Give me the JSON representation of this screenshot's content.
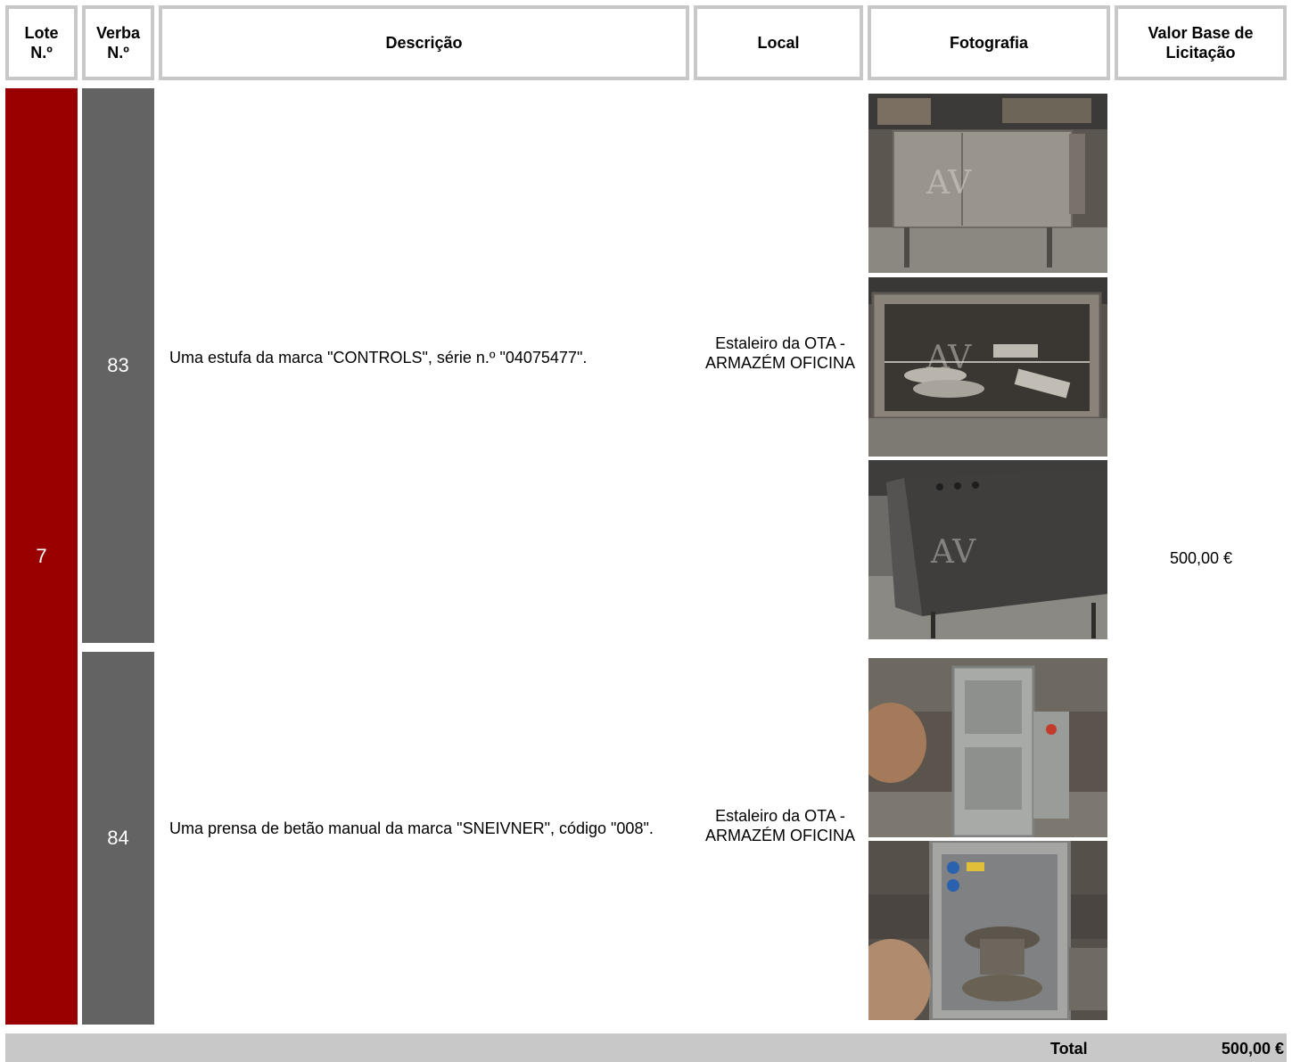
{
  "header": {
    "lote": "Lote\nN.º",
    "verba": "Verba\nN.º",
    "descricao": "Descrição",
    "local": "Local",
    "fotografia": "Fotografia",
    "valor": "Valor Base de\nLicitação"
  },
  "lot": {
    "number": "7",
    "value": "500,00 €",
    "items": [
      {
        "verba": "83",
        "description": "Uma estufa da marca \"CONTROLS\", série n.º \"04075477\".",
        "location": "Estaleiro da OTA - ARMAZÉM OFICINA"
      },
      {
        "verba": "84",
        "description": "Uma prensa de betão manual da marca \"SNEIVNER\", código \"008\".",
        "location": "Estaleiro da OTA - ARMAZÉM OFICINA"
      }
    ]
  },
  "footer": {
    "total_label": "Total",
    "total_value": "500,00 €"
  },
  "colors": {
    "lote_bg": "#990000",
    "verba_bg": "#636363",
    "header_border": "#c8c8c8"
  }
}
